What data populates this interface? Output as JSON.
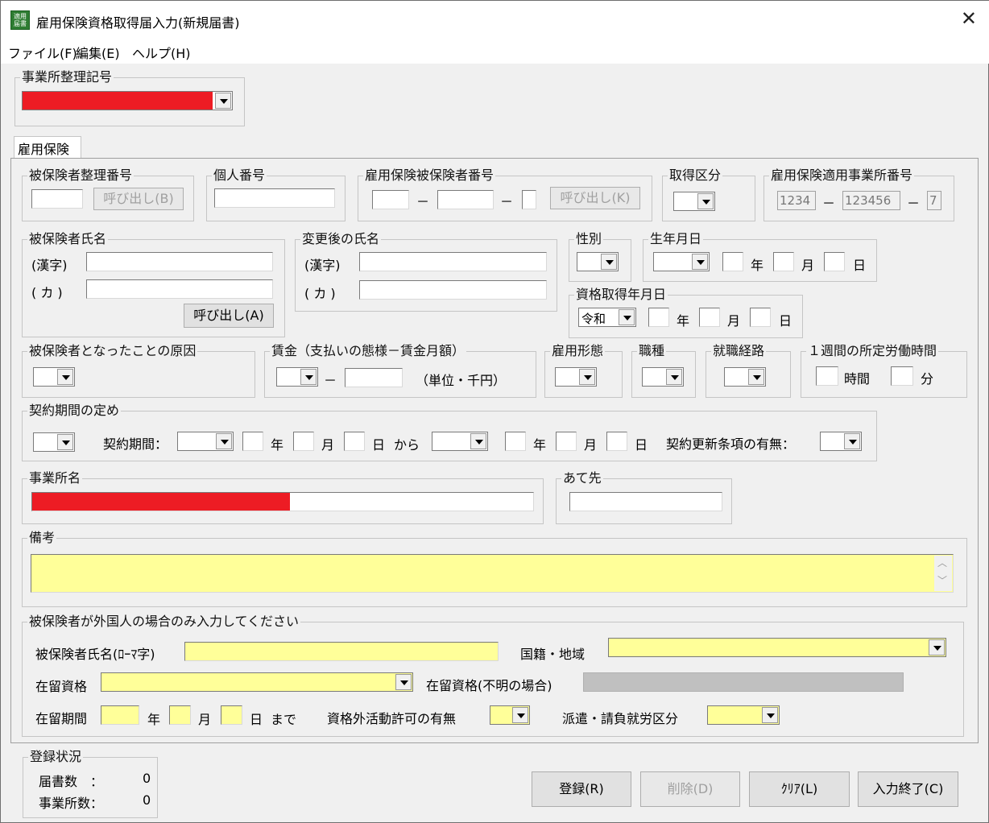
{
  "window": {
    "title": "雇用保険資格取得届入力(新規届書)",
    "icon_text": "適用届書",
    "close": "✕"
  },
  "menu": [
    "ファイル(F)",
    "編集(E)",
    "ヘルプ(H)"
  ],
  "office_code": {
    "legend": "事業所整理記号"
  },
  "tab": {
    "label": "雇用保険"
  },
  "insured_mgmt": {
    "legend": "被保険者整理番号",
    "call_button": "呼び出し(B)"
  },
  "my_number": {
    "legend": "個人番号"
  },
  "insured_no": {
    "legend": "雇用保険被保険者番号",
    "dash": "－",
    "call_button": "呼び出し(K)"
  },
  "acq_type": {
    "legend": "取得区分"
  },
  "office_no": {
    "legend": "雇用保険適用事業所番号",
    "part1": "1234",
    "part2": "123456",
    "part3": "7",
    "dash": "－"
  },
  "name": {
    "legend": "被保険者氏名",
    "kanji": "(漢字)",
    "kana": "( カ )",
    "call_button": "呼び出し(A)"
  },
  "new_name": {
    "legend": "変更後の氏名",
    "kanji": "(漢字)",
    "kana": "( カ )"
  },
  "gender": {
    "legend": "性別"
  },
  "birth": {
    "legend": "生年月日",
    "year": "年",
    "month": "月",
    "day": "日"
  },
  "acq_date": {
    "legend": "資格取得年月日",
    "era": "令和",
    "year": "年",
    "month": "月",
    "day": "日"
  },
  "cause": {
    "legend": "被保険者となったことの原因"
  },
  "wage": {
    "legend": "賃金（支払いの態様－賃金月額）",
    "dash": "－",
    "unit": "（単位・千円）"
  },
  "employment_type": {
    "legend": "雇用形態"
  },
  "occupation": {
    "legend": "職種"
  },
  "route": {
    "legend": "就職経路"
  },
  "weekly_hours": {
    "legend": "１週間の所定労働時間",
    "hours": "時間",
    "minutes": "分"
  },
  "contract": {
    "legend": "契約期間の定め",
    "period_label": "契約期間：",
    "year": "年",
    "month": "月",
    "day": "日",
    "from": "から",
    "renewal_label": "契約更新条項の有無："
  },
  "office_name": {
    "legend": "事業所名"
  },
  "destination": {
    "legend": "あて先"
  },
  "remarks": {
    "legend": "備考"
  },
  "foreign": {
    "legend": "被保険者が外国人の場合のみ入力してください",
    "name_roman": "被保険者氏名(ﾛｰﾏ字)",
    "nationality": "国籍・地域",
    "status": "在留資格",
    "status_unknown": "在留資格(不明の場合)",
    "period": "在留期間",
    "year": "年",
    "month": "月",
    "day": "日",
    "until": "まで",
    "outside_activity": "資格外活動許可の有無",
    "dispatch": "派遣・請負就労区分"
  },
  "registration": {
    "legend": "登録状況",
    "forms_label": "届書数　：",
    "forms_count": "0",
    "offices_label": "事業所数：",
    "offices_count": "0"
  },
  "buttons": {
    "register": "登録(R)",
    "delete": "削除(D)",
    "clear": "ｸﾘｱ(L)",
    "finish": "入力終了(C)"
  },
  "colors": {
    "redact": "#ed1c24",
    "required": "#ffff99"
  }
}
